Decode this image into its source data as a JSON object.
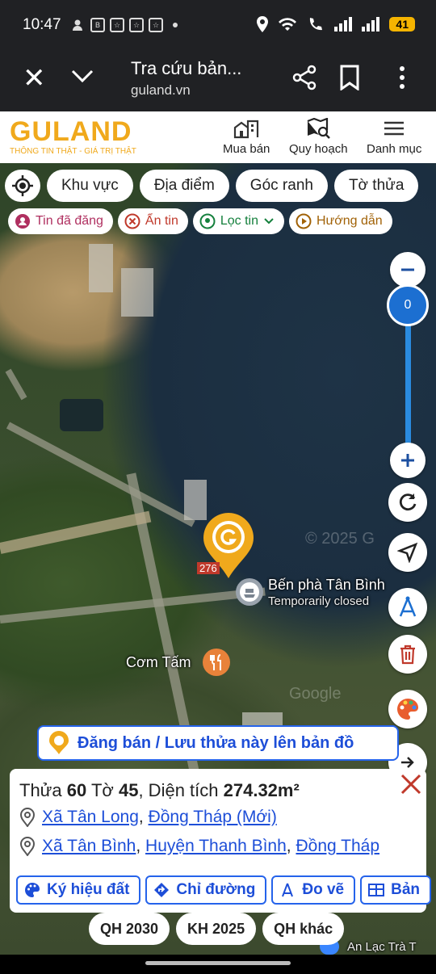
{
  "status": {
    "time": "10:47",
    "battery": "41"
  },
  "browser": {
    "title": "Tra cứu bản...",
    "url": "guland.vn"
  },
  "site": {
    "logo_text": "GULAND",
    "logo_tagline": "THÔNG TIN THẬT - GIÁ TRỊ THẬT",
    "nav": [
      {
        "label": "Mua bán",
        "icon": "building-icon"
      },
      {
        "label": "Quy hoạch",
        "icon": "map-search-icon"
      },
      {
        "label": "Danh mục",
        "icon": "menu-icon"
      }
    ]
  },
  "filters": [
    "Khu vực",
    "Địa điểm",
    "Góc ranh",
    "Tờ thửa"
  ],
  "chips": [
    {
      "label": "Tin đã đăng",
      "color": "#b03060",
      "icon": "person-pin-icon"
    },
    {
      "label": "Ẩn tin",
      "color": "#c0392b",
      "icon": "close-circle-icon"
    },
    {
      "label": "Lọc tin",
      "color": "#15803d",
      "icon": "location-pin-icon"
    },
    {
      "label": "Hướng dẫn",
      "color": "#a16207",
      "icon": "play-circle-icon"
    }
  ],
  "zoom": {
    "value": "0"
  },
  "map_labels": {
    "ferry_name": "Bến phà Tân Bình",
    "ferry_status": "Temporarily closed",
    "restaurant": "Cơm Tấm",
    "bottom_place": "An Lạc Trà T",
    "parcel_number": "276",
    "watermark_copyright": "© 2025 G",
    "watermark_google": "Google"
  },
  "post_banner": "Đăng bán / Lưu thửa này lên bản đồ",
  "info": {
    "plot_label": "Thửa",
    "plot_no": "60",
    "sheet_label": "Tờ",
    "sheet_no": "45",
    "area_label": ", Diện tích",
    "area_value": "274.32m²",
    "addr1": {
      "commune": "Xã Tân Long",
      "province": "Đồng Tháp (Mới)"
    },
    "addr2": {
      "commune": "Xã Tân Bình",
      "district": "Huyện Thanh Bình",
      "province": "Đồng Tháp"
    },
    "actions": [
      "Ký hiệu đất",
      "Chỉ đường",
      "Đo vẽ",
      "Bản"
    ]
  },
  "bottom_pills": [
    "QH 2030",
    "KH 2025",
    "QH khác"
  ],
  "colors": {
    "brand": "#f0a91c",
    "link": "#1d4ed8",
    "zoom_blue": "#1c6fd1"
  }
}
